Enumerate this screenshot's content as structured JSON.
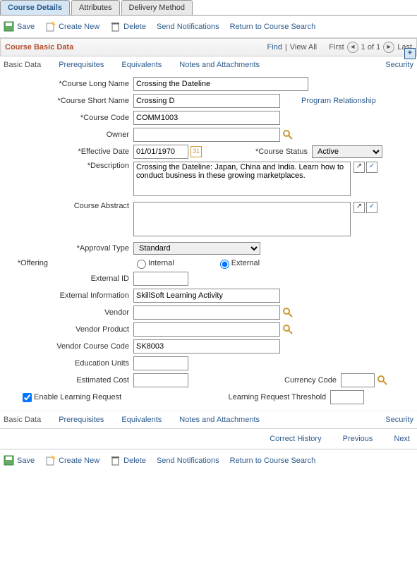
{
  "tabs": {
    "t0": "Course Details",
    "t1": "Attributes",
    "t2": "Delivery Method"
  },
  "toolbar": {
    "save": "Save",
    "create": "Create New",
    "delete": "Delete",
    "send": "Send Notifications",
    "return": "Return to Course Search"
  },
  "section": {
    "title": "Course Basic Data",
    "find": "Find",
    "viewall": "View All",
    "first": "First",
    "counter": "1 of 1",
    "last": "Last"
  },
  "subnav": {
    "basic": "Basic Data",
    "prereq": "Prerequisites",
    "equiv": "Equivalents",
    "notes": "Notes and Attachments",
    "security": "Security"
  },
  "labels": {
    "longname": "*Course Long Name",
    "shortname": "*Course Short Name",
    "code": "*Course Code",
    "owner": "Owner",
    "effdate": "*Effective Date",
    "status": "*Course Status",
    "desc": "*Description",
    "abstract": "Course Abstract",
    "approval": "*Approval Type",
    "offering": "*Offering",
    "internal": "Internal",
    "external": "External",
    "extid": "External ID",
    "extinfo": "External Information",
    "vendor": "Vendor",
    "vproduct": "Vendor Product",
    "vcode": "Vendor Course Code",
    "edunits": "Education Units",
    "estcost": "Estimated Cost",
    "currency": "Currency Code",
    "enable": "Enable Learning Request",
    "threshold": "Learning Request Threshold",
    "progrel": "Program Relationship"
  },
  "values": {
    "longname": "Crossing the Dateline",
    "shortname": "Crossing D",
    "code": "COMM1003",
    "owner": "",
    "effdate": "01/01/1970",
    "status": "Active",
    "desc": "Crossing the Dateline: Japan, China and India. Learn how to conduct business in these growing marketplaces.",
    "abstract": "",
    "approval": "Standard",
    "extid": "",
    "extinfo": "SkillSoft Learning Activity",
    "vendor": "",
    "vproduct": "",
    "vcode": "SK8003",
    "edunits": "",
    "estcost": "",
    "currency": "",
    "threshold": ""
  },
  "footer": {
    "correct": "Correct History",
    "prev": "Previous",
    "next": "Next"
  }
}
